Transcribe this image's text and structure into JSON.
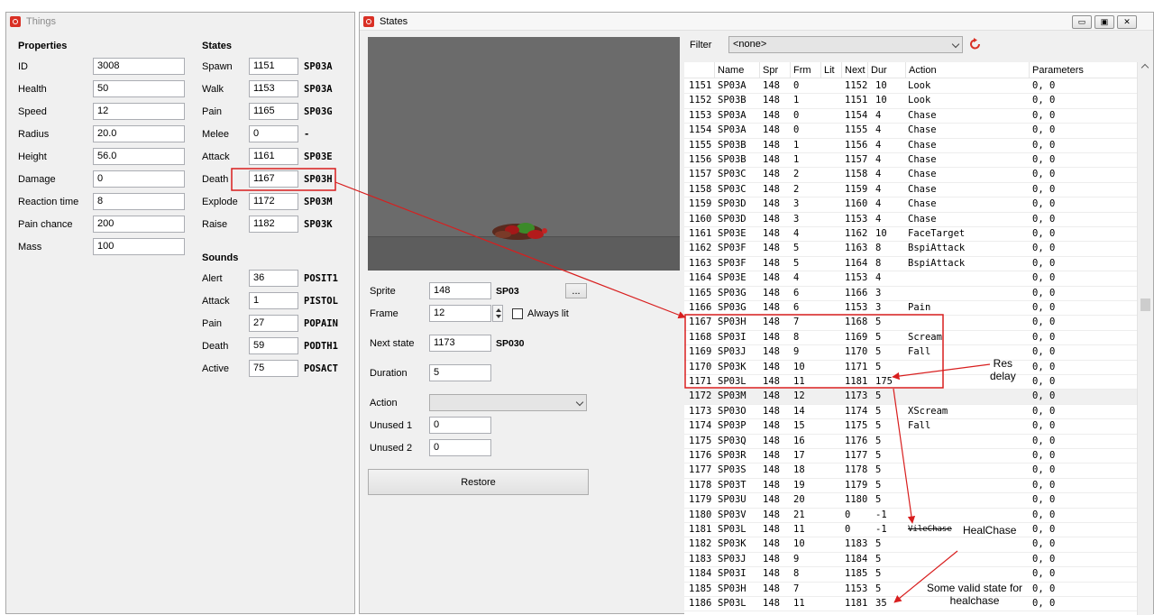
{
  "things": {
    "title": "Things",
    "properties_heading": "Properties",
    "states_heading": "States",
    "sounds_heading": "Sounds",
    "properties": [
      {
        "label": "ID",
        "value": "3008"
      },
      {
        "label": "Health",
        "value": "50"
      },
      {
        "label": "Speed",
        "value": "12"
      },
      {
        "label": "Radius",
        "value": "20.0"
      },
      {
        "label": "Height",
        "value": "56.0"
      },
      {
        "label": "Damage",
        "value": "0"
      },
      {
        "label": "Reaction time",
        "value": "8"
      },
      {
        "label": "Pain chance",
        "value": "200"
      },
      {
        "label": "Mass",
        "value": "100"
      }
    ],
    "states": [
      {
        "label": "Spawn",
        "value": "1151",
        "code": "SP03A"
      },
      {
        "label": "Walk",
        "value": "1153",
        "code": "SP03A"
      },
      {
        "label": "Pain",
        "value": "1165",
        "code": "SP03G"
      },
      {
        "label": "Melee",
        "value": "0",
        "code": "-"
      },
      {
        "label": "Attack",
        "value": "1161",
        "code": "SP03E"
      },
      {
        "label": "Death",
        "value": "1167",
        "code": "SP03H"
      },
      {
        "label": "Explode",
        "value": "1172",
        "code": "SP03M"
      },
      {
        "label": "Raise",
        "value": "1182",
        "code": "SP03K"
      }
    ],
    "sounds": [
      {
        "label": "Alert",
        "value": "36",
        "code": "POSIT1"
      },
      {
        "label": "Attack",
        "value": "1",
        "code": "PISTOL"
      },
      {
        "label": "Pain",
        "value": "27",
        "code": "POPAIN"
      },
      {
        "label": "Death",
        "value": "59",
        "code": "PODTH1"
      },
      {
        "label": "Active",
        "value": "75",
        "code": "POSACT"
      }
    ]
  },
  "states_window": {
    "title": "States",
    "sprite_label": "Sprite",
    "sprite_value": "148",
    "sprite_code": "SP03",
    "browse_label": "...",
    "frame_label": "Frame",
    "frame_value": "12",
    "always_lit_label": "Always lit",
    "next_state_label": "Next state",
    "next_state_value": "1173",
    "next_state_code": "SP030",
    "duration_label": "Duration",
    "duration_value": "5",
    "action_label": "Action",
    "action_value": "",
    "unused1_label": "Unused 1",
    "unused1_value": "0",
    "unused2_label": "Unused 2",
    "unused2_value": "0",
    "restore_label": "Restore",
    "filter_label": "Filter",
    "filter_value": "<none>",
    "columns": [
      "Name",
      "Spr",
      "Frm",
      "Lit",
      "Next",
      "Dur",
      "Action",
      "Parameters"
    ],
    "rows": [
      [
        "1151",
        "SP03A",
        "148",
        "0",
        "",
        "1152",
        "10",
        "Look",
        "0, 0"
      ],
      [
        "1152",
        "SP03B",
        "148",
        "1",
        "",
        "1151",
        "10",
        "Look",
        "0, 0"
      ],
      [
        "1153",
        "SP03A",
        "148",
        "0",
        "",
        "1154",
        "4",
        "Chase",
        "0, 0"
      ],
      [
        "1154",
        "SP03A",
        "148",
        "0",
        "",
        "1155",
        "4",
        "Chase",
        "0, 0"
      ],
      [
        "1155",
        "SP03B",
        "148",
        "1",
        "",
        "1156",
        "4",
        "Chase",
        "0, 0"
      ],
      [
        "1156",
        "SP03B",
        "148",
        "1",
        "",
        "1157",
        "4",
        "Chase",
        "0, 0"
      ],
      [
        "1157",
        "SP03C",
        "148",
        "2",
        "",
        "1158",
        "4",
        "Chase",
        "0, 0"
      ],
      [
        "1158",
        "SP03C",
        "148",
        "2",
        "",
        "1159",
        "4",
        "Chase",
        "0, 0"
      ],
      [
        "1159",
        "SP03D",
        "148",
        "3",
        "",
        "1160",
        "4",
        "Chase",
        "0, 0"
      ],
      [
        "1160",
        "SP03D",
        "148",
        "3",
        "",
        "1153",
        "4",
        "Chase",
        "0, 0"
      ],
      [
        "1161",
        "SP03E",
        "148",
        "4",
        "",
        "1162",
        "10",
        "FaceTarget",
        "0, 0"
      ],
      [
        "1162",
        "SP03F",
        "148",
        "5",
        "",
        "1163",
        "8",
        "BspiAttack",
        "0, 0"
      ],
      [
        "1163",
        "SP03F",
        "148",
        "5",
        "",
        "1164",
        "8",
        "BspiAttack",
        "0, 0"
      ],
      [
        "1164",
        "SP03E",
        "148",
        "4",
        "",
        "1153",
        "4",
        "",
        "0, 0"
      ],
      [
        "1165",
        "SP03G",
        "148",
        "6",
        "",
        "1166",
        "3",
        "",
        "0, 0"
      ],
      [
        "1166",
        "SP03G",
        "148",
        "6",
        "",
        "1153",
        "3",
        "Pain",
        "0, 0"
      ],
      [
        "1167",
        "SP03H",
        "148",
        "7",
        "",
        "1168",
        "5",
        "",
        "0, 0"
      ],
      [
        "1168",
        "SP03I",
        "148",
        "8",
        "",
        "1169",
        "5",
        "Scream",
        "0, 0"
      ],
      [
        "1169",
        "SP03J",
        "148",
        "9",
        "",
        "1170",
        "5",
        "Fall",
        "0, 0"
      ],
      [
        "1170",
        "SP03K",
        "148",
        "10",
        "",
        "1171",
        "5",
        "",
        "0, 0"
      ],
      [
        "1171",
        "SP03L",
        "148",
        "11",
        "",
        "1181",
        "175",
        "",
        "0, 0"
      ],
      [
        "1172",
        "SP03M",
        "148",
        "12",
        "",
        "1173",
        "5",
        "",
        "0, 0"
      ],
      [
        "1173",
        "SP03O",
        "148",
        "14",
        "",
        "1174",
        "5",
        "XScream",
        "0, 0"
      ],
      [
        "1174",
        "SP03P",
        "148",
        "15",
        "",
        "1175",
        "5",
        "Fall",
        "0, 0"
      ],
      [
        "1175",
        "SP03Q",
        "148",
        "16",
        "",
        "1176",
        "5",
        "",
        "0, 0"
      ],
      [
        "1176",
        "SP03R",
        "148",
        "17",
        "",
        "1177",
        "5",
        "",
        "0, 0"
      ],
      [
        "1177",
        "SP03S",
        "148",
        "18",
        "",
        "1178",
        "5",
        "",
        "0, 0"
      ],
      [
        "1178",
        "SP03T",
        "148",
        "19",
        "",
        "1179",
        "5",
        "",
        "0, 0"
      ],
      [
        "1179",
        "SP03U",
        "148",
        "20",
        "",
        "1180",
        "5",
        "",
        "0, 0"
      ],
      [
        "1180",
        "SP03V",
        "148",
        "21",
        "",
        "0",
        "-1",
        "",
        "0, 0"
      ],
      [
        "1181",
        "SP03L",
        "148",
        "11",
        "",
        "0",
        "-1",
        "VileChase",
        "0, 0"
      ],
      [
        "1182",
        "SP03K",
        "148",
        "10",
        "",
        "1183",
        "5",
        "",
        "0, 0"
      ],
      [
        "1183",
        "SP03J",
        "148",
        "9",
        "",
        "1184",
        "5",
        "",
        "0, 0"
      ],
      [
        "1184",
        "SP03I",
        "148",
        "8",
        "",
        "1185",
        "5",
        "",
        "0, 0"
      ],
      [
        "1185",
        "SP03H",
        "148",
        "7",
        "",
        "1153",
        "5",
        "",
        "0, 0"
      ],
      [
        "1186",
        "SP03L",
        "148",
        "11",
        "",
        "1181",
        "35",
        "",
        "0, 0"
      ]
    ]
  },
  "annotations": {
    "res_delay": "Res\ndelay",
    "heal_chase": "HealChase",
    "valid_state": "Some valid state for\nhealchase"
  },
  "colors": {
    "annotation": "#d81e1e",
    "window_bg": "#f0f0f0"
  }
}
